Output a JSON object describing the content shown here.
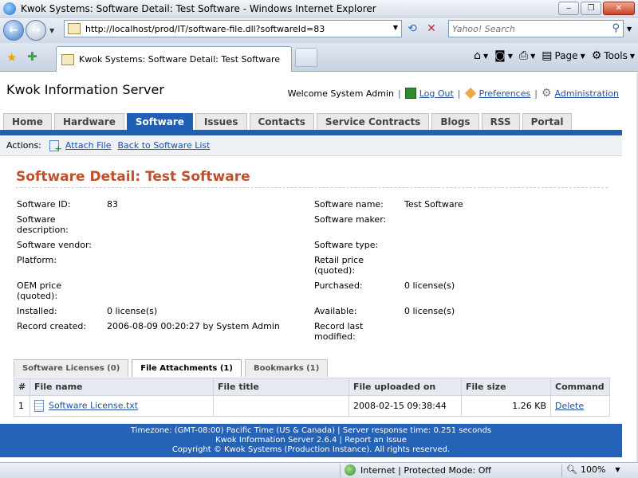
{
  "browser": {
    "window_title": "Kwok Systems: Software Detail: Test Software - Windows Internet Explorer",
    "url": "http://localhost/prod/IT/software-file.dll?softwareId=83",
    "search_placeholder": "Yahoo! Search",
    "tab_title": "Kwok Systems: Software Detail: Test Software",
    "commands": {
      "page": "Page",
      "tools": "Tools"
    },
    "status_zone": "Internet | Protected Mode: Off",
    "zoom": "100%"
  },
  "app": {
    "title": "Kwok Information Server",
    "welcome": "Welcome System Admin",
    "logout": "Log Out",
    "preferences": "Preferences",
    "administration": "Administration"
  },
  "nav": {
    "tabs": [
      "Home",
      "Hardware",
      "Software",
      "Issues",
      "Contacts",
      "Service Contracts",
      "Blogs",
      "RSS",
      "Portal"
    ],
    "active": "Software"
  },
  "actions": {
    "label": "Actions:",
    "attach": "Attach File",
    "back": "Back to Software List"
  },
  "detail": {
    "heading": "Software Detail: Test Software",
    "fields": {
      "software_id": {
        "label": "Software ID:",
        "value": "83"
      },
      "software_name": {
        "label": "Software name:",
        "value": "Test Software"
      },
      "software_description": {
        "label": "Software description:",
        "value": ""
      },
      "software_maker": {
        "label": "Software maker:",
        "value": ""
      },
      "software_vendor": {
        "label": "Software vendor:",
        "value": ""
      },
      "software_type": {
        "label": "Software type:",
        "value": ""
      },
      "platform": {
        "label": "Platform:",
        "value": ""
      },
      "retail_price": {
        "label": "Retail price (quoted):",
        "value": ""
      },
      "oem_price": {
        "label": "OEM price (quoted):",
        "value": ""
      },
      "purchased": {
        "label": "Purchased:",
        "value": "0 license(s)"
      },
      "installed": {
        "label": "Installed:",
        "value": "0 license(s)"
      },
      "available": {
        "label": "Available:",
        "value": "0 license(s)"
      },
      "record_created": {
        "label": "Record created:",
        "value": "2006-08-09 00:20:27 by System Admin"
      },
      "record_last_modified": {
        "label": "Record last modified:",
        "value": ""
      }
    }
  },
  "subtabs": {
    "licenses": "Software Licenses (0)",
    "attachments": "File Attachments (1)",
    "bookmarks": "Bookmarks (1)",
    "active": "File Attachments (1)"
  },
  "files_table": {
    "headers": [
      "#",
      "File name",
      "File title",
      "File uploaded on",
      "File size",
      "Command"
    ],
    "rows": [
      {
        "num": "1",
        "name": "Software License.txt",
        "title": "",
        "uploaded": "2008-02-15 09:38:44",
        "size": "1.26 KB",
        "command": "Delete"
      }
    ]
  },
  "footer": {
    "line1": "Timezone: (GMT-08:00) Pacific Time (US & Canada) | Server response time: 0.251 seconds",
    "line2": "Kwok Information Server 2.6.4 | Report an Issue",
    "line3": "Copyright © Kwok Systems (Production Instance). All rights reserved."
  }
}
